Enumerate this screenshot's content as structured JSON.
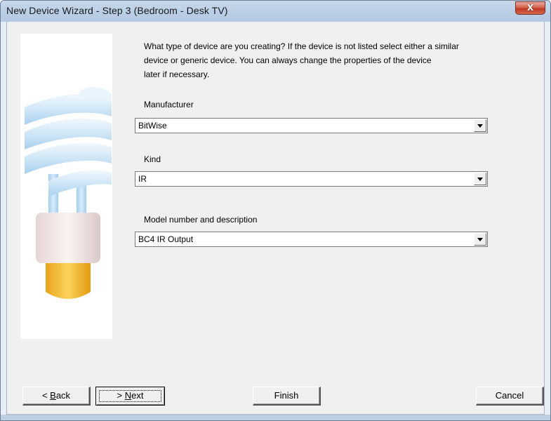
{
  "window": {
    "title": "New Device Wizard - Step 3 (Bedroom - Desk TV)",
    "close_label": "X"
  },
  "intro": {
    "line1": "What type of device are you creating?  If the device is not listed select either a similar",
    "line2": "device or generic device.  You can always change the properties of the device",
    "line3": "later if necessary."
  },
  "fields": {
    "manufacturer": {
      "label": "Manufacturer",
      "value": "BitWise"
    },
    "kind": {
      "label": "Kind",
      "value": "IR"
    },
    "model": {
      "label": "Model number and description",
      "value": "BC4 IR Output"
    }
  },
  "buttons": {
    "back": {
      "prefix": "< ",
      "accel": "B",
      "rest": "ack"
    },
    "next": {
      "prefix": "> ",
      "accel": "N",
      "rest": "ext"
    },
    "finish": "Finish",
    "cancel": "Cancel"
  },
  "icons": {
    "wizard_image": "cfl-bulb-icon",
    "dropdown": "chevron-down-icon"
  },
  "colors": {
    "titlebar": "#bcd0e6",
    "close_button": "#c8432a",
    "dialog_background": "#f0f0f0"
  }
}
